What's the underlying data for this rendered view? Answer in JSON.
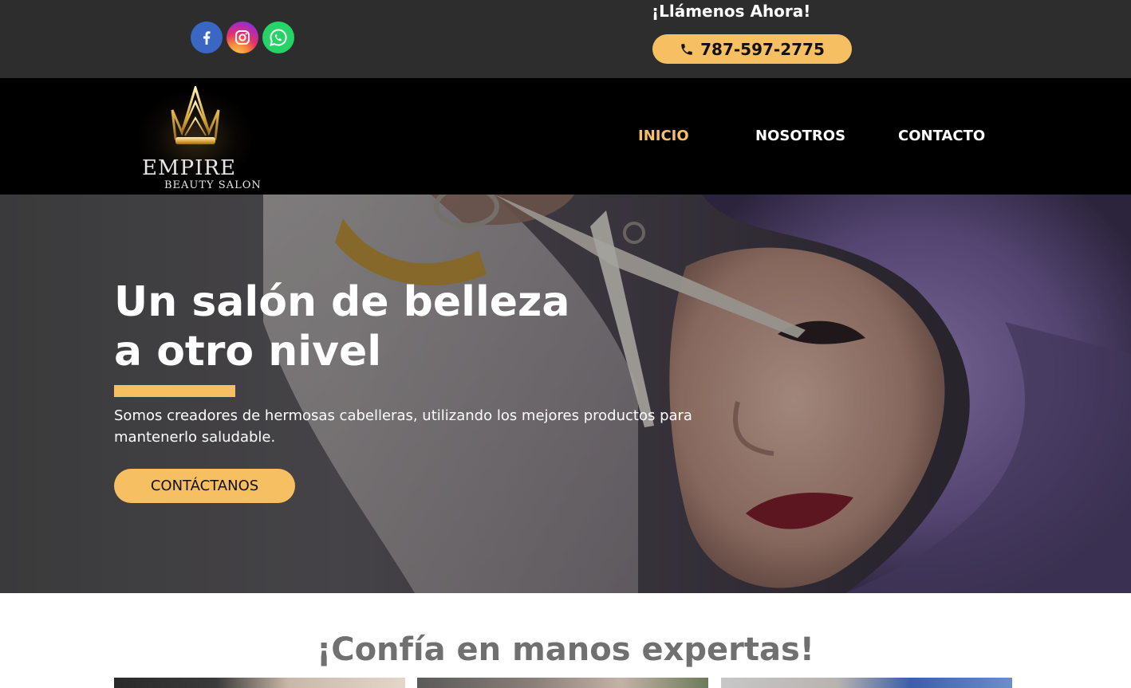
{
  "topbar": {
    "social": [
      {
        "name": "facebook",
        "icon": "facebook-icon"
      },
      {
        "name": "instagram",
        "icon": "instagram-icon"
      },
      {
        "name": "whatsapp",
        "icon": "whatsapp-icon"
      }
    ],
    "call_title": "¡Llámenos Ahora!",
    "phone": "787-597-2775",
    "phone_icon": "phone-icon"
  },
  "brand": {
    "name": "EMPIRE",
    "subtitle": "BEAUTY SALON",
    "logo_icon": "crown-icon"
  },
  "nav": {
    "items": [
      {
        "label": "INICIO",
        "active": true
      },
      {
        "label": "NOSOTROS",
        "active": false
      },
      {
        "label": "CONTACTO",
        "active": false
      }
    ]
  },
  "hero": {
    "title_line1": "Un salón de belleza",
    "title_line2": "a otro nivel",
    "description": "Somos creadores de hermosas cabelleras, utilizando los mejores productos para mantenerlo saludable.",
    "cta_label": "CONTÁCTANOS"
  },
  "section": {
    "title": "¡Confía en manos expertas!"
  },
  "colors": {
    "accent": "#f6c062",
    "topbar_bg": "#2d2d2d",
    "nav_bg": "#000000",
    "section_title": "#707070"
  }
}
